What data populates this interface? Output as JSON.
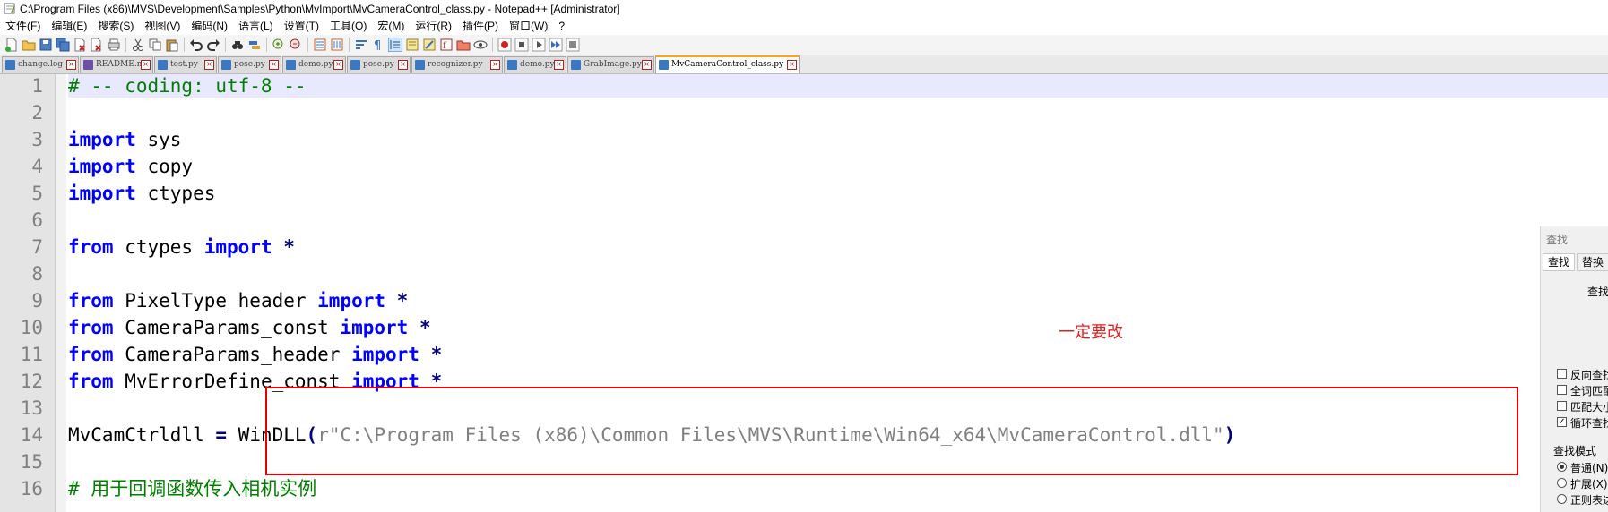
{
  "window": {
    "title": "C:\\Program Files (x86)\\MVS\\Development\\Samples\\Python\\MvImport\\MvCameraControl_class.py - Notepad++ [Administrator]"
  },
  "menu": [
    "文件(F)",
    "编辑(E)",
    "搜索(S)",
    "视图(V)",
    "编码(N)",
    "语言(L)",
    "设置(T)",
    "工具(O)",
    "宏(M)",
    "运行(R)",
    "插件(P)",
    "窗口(W)",
    "?"
  ],
  "tabs": [
    {
      "label": "change.log",
      "active": false
    },
    {
      "label": "README.md",
      "active": false
    },
    {
      "label": "test.py",
      "active": false
    },
    {
      "label": "pose.py",
      "active": false
    },
    {
      "label": "demo.py",
      "active": false
    },
    {
      "label": "pose.py",
      "active": false
    },
    {
      "label": "recognizer.py",
      "active": false
    },
    {
      "label": "demo.py",
      "active": false
    },
    {
      "label": "GrabImage.py",
      "active": false
    },
    {
      "label": "MvCameraControl_class.py",
      "active": true
    }
  ],
  "editor": {
    "line_numbers": [
      "1",
      "2",
      "3",
      "4",
      "5",
      "6",
      "7",
      "8",
      "9",
      "10",
      "11",
      "12",
      "13",
      "14",
      "15",
      "16"
    ],
    "lines": [
      {
        "parts": [
          {
            "t": "# -- coding: utf-8 --",
            "c": "cm"
          }
        ]
      },
      {
        "parts": []
      },
      {
        "parts": [
          {
            "t": "import",
            "c": "kw"
          },
          {
            "t": " sys",
            "c": ""
          }
        ]
      },
      {
        "parts": [
          {
            "t": "import",
            "c": "kw"
          },
          {
            "t": " copy",
            "c": ""
          }
        ]
      },
      {
        "parts": [
          {
            "t": "import",
            "c": "kw"
          },
          {
            "t": " ctypes",
            "c": ""
          }
        ]
      },
      {
        "parts": []
      },
      {
        "parts": [
          {
            "t": "from",
            "c": "kw"
          },
          {
            "t": " ctypes ",
            "c": ""
          },
          {
            "t": "import",
            "c": "kw"
          },
          {
            "t": " ",
            "c": ""
          },
          {
            "t": "*",
            "c": "op"
          }
        ]
      },
      {
        "parts": []
      },
      {
        "parts": [
          {
            "t": "from",
            "c": "kw"
          },
          {
            "t": " PixelType_header ",
            "c": ""
          },
          {
            "t": "import",
            "c": "kw"
          },
          {
            "t": " ",
            "c": ""
          },
          {
            "t": "*",
            "c": "op"
          }
        ]
      },
      {
        "parts": [
          {
            "t": "from",
            "c": "kw"
          },
          {
            "t": " CameraParams_const ",
            "c": ""
          },
          {
            "t": "import",
            "c": "kw"
          },
          {
            "t": " ",
            "c": ""
          },
          {
            "t": "*",
            "c": "op"
          }
        ]
      },
      {
        "parts": [
          {
            "t": "from",
            "c": "kw"
          },
          {
            "t": " CameraParams_header ",
            "c": ""
          },
          {
            "t": "import",
            "c": "kw"
          },
          {
            "t": " ",
            "c": ""
          },
          {
            "t": "*",
            "c": "op"
          }
        ]
      },
      {
        "parts": [
          {
            "t": "from",
            "c": "kw"
          },
          {
            "t": " MvErrorDefine_const ",
            "c": ""
          },
          {
            "t": "import",
            "c": "kw"
          },
          {
            "t": " ",
            "c": ""
          },
          {
            "t": "*",
            "c": "op"
          }
        ]
      },
      {
        "parts": []
      },
      {
        "parts": [
          {
            "t": "MvCamCtrldll ",
            "c": ""
          },
          {
            "t": "=",
            "c": "op"
          },
          {
            "t": " WinDLL",
            "c": ""
          },
          {
            "t": "(",
            "c": "op"
          },
          {
            "t": "r\"C:\\Program Files (x86)\\Common Files\\MVS\\Runtime\\Win64_x64\\MvCameraControl.dll\"",
            "c": "str"
          },
          {
            "t": ")",
            "c": "op"
          }
        ]
      },
      {
        "parts": []
      },
      {
        "parts": [
          {
            "t": "# 用于回调函数传入相机实例",
            "c": "cm"
          }
        ]
      }
    ]
  },
  "annotation": {
    "text": "一定要改",
    "color": "#e60000"
  },
  "find_panel": {
    "title": "查找",
    "tabs": [
      "查找",
      "替换"
    ],
    "find_label": "查找",
    "options": [
      {
        "label": "反向查找",
        "checked": false
      },
      {
        "label": "全词匹配",
        "checked": false
      },
      {
        "label": "匹配大小",
        "checked": false
      },
      {
        "label": "循环查找",
        "checked": true
      }
    ],
    "mode_label": "查找模式",
    "modes": [
      {
        "label": "普通(N)",
        "selected": true
      },
      {
        "label": "扩展(X)",
        "selected": false
      },
      {
        "label": "正则表达",
        "selected": false
      }
    ]
  },
  "colors": {
    "keyword": "#0000ff",
    "comment": "#008000",
    "string": "#808080",
    "highlight": "#e8e8ff",
    "tab_accent": "#f9a51a"
  }
}
